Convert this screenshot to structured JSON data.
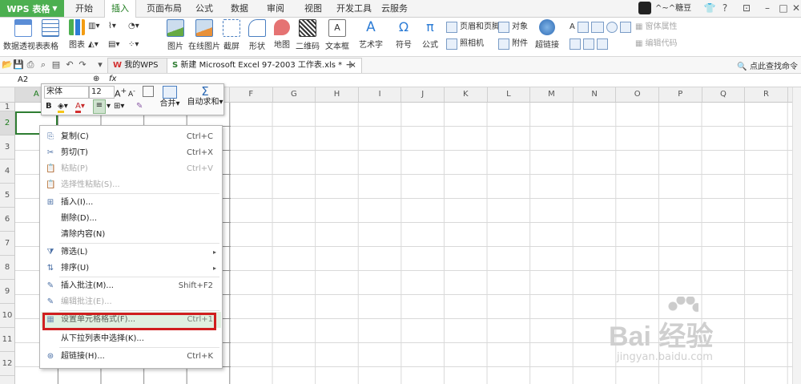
{
  "app": {
    "name": "WPS 表格"
  },
  "menu_tabs": [
    "开始",
    "插入",
    "页面布局",
    "公式",
    "数据",
    "审阅",
    "视图",
    "开发工具",
    "云服务"
  ],
  "active_tab": "插入",
  "user": {
    "name": "^~^糖豆"
  },
  "ribbon": {
    "pivot": "数据透视表",
    "table": "表格",
    "chart": "图表",
    "picture": "图片",
    "online_picture": "在线图片",
    "screenshot": "截屏",
    "shapes": "形状",
    "map": "地图",
    "qrcode": "二维码",
    "textbox": "文本框",
    "wordart": "艺术字",
    "symbol": "符号",
    "formula": "公式",
    "header_footer": "页眉和页脚",
    "camera": "照相机",
    "object": "对象",
    "attachment": "附件",
    "hyperlink": "超链接",
    "control_props": "窗体属性",
    "edit_code": "编辑代码"
  },
  "doc_tabs": {
    "mywps": "我的WPS",
    "file": "新建 Microsoft Excel 97-2003 工作表.xls *"
  },
  "search_cmd": "点此查找命令",
  "name_box": "A2",
  "fx": "fx",
  "columns": [
    "A",
    "B",
    "C",
    "D",
    "E",
    "F",
    "G",
    "H",
    "I",
    "J",
    "K",
    "L",
    "M",
    "N",
    "O",
    "P",
    "Q",
    "R"
  ],
  "rows": [
    "1",
    "2",
    "3",
    "4",
    "5",
    "6",
    "7",
    "8",
    "9",
    "10",
    "11",
    "12"
  ],
  "mini_toolbar": {
    "font": "宋体",
    "size": "12",
    "merge": "合并",
    "autosum": "自动求和",
    "bold": "B"
  },
  "context_menu": [
    {
      "label": "复制(C)",
      "shortcut": "Ctrl+C"
    },
    {
      "label": "剪切(T)",
      "shortcut": "Ctrl+X"
    },
    {
      "label": "粘贴(P)",
      "shortcut": "Ctrl+V"
    },
    {
      "label": "选择性粘贴(S)..."
    },
    {
      "label": "插入(I)..."
    },
    {
      "label": "删除(D)..."
    },
    {
      "label": "清除内容(N)"
    },
    {
      "label": "筛选(L)"
    },
    {
      "label": "排序(U)"
    },
    {
      "label": "插入批注(M)...",
      "shortcut": "Shift+F2"
    },
    {
      "label": "编辑批注(E)..."
    },
    {
      "label": "设置单元格格式(F)...",
      "shortcut": "Ctrl+1"
    },
    {
      "label": "从下拉列表中选择(K)..."
    },
    {
      "label": "超链接(H)...",
      "shortcut": "Ctrl+K"
    }
  ],
  "watermark": {
    "brand": "Bai 经验",
    "url": "jingyan.baidu.com"
  }
}
